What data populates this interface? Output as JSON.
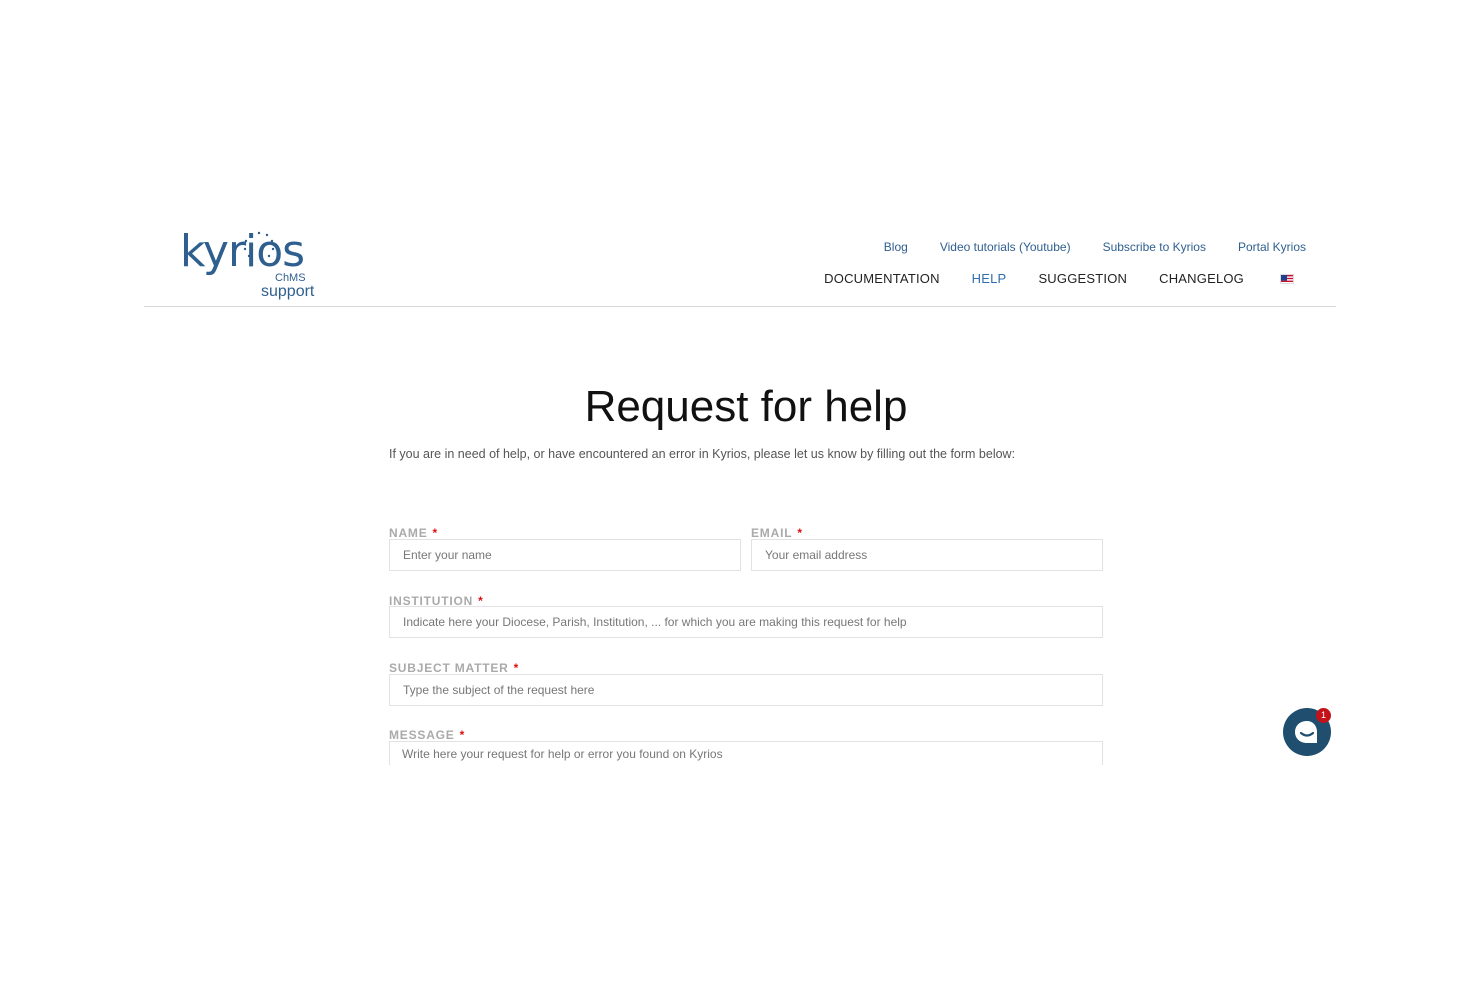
{
  "logo": {
    "word": "kyrios",
    "chms": "ChMS",
    "support": "support"
  },
  "top_links": [
    "Blog",
    "Video tutorials (Youtube)",
    "Subscribe to Kyrios",
    "Portal Kyrios"
  ],
  "nav": {
    "documentation": "DOCUMENTATION",
    "help": "HELP",
    "suggestion": "SUGGESTION",
    "changelog": "CHANGELOG"
  },
  "page": {
    "title": "Request for help",
    "intro": "If you are in need of help, or have encountered an error in Kyrios, please let us know by filling out the form below:"
  },
  "form": {
    "required_mark": "*",
    "name": {
      "label": "NAME",
      "placeholder": "Enter your name"
    },
    "email": {
      "label": "EMAIL",
      "placeholder": "Your email address"
    },
    "institution": {
      "label": "INSTITUTION",
      "placeholder": "Indicate here your Diocese, Parish, Institution, ... for which you are making this request for help"
    },
    "subject": {
      "label": "SUBJECT MATTER",
      "placeholder": "Type the subject of the request here"
    },
    "message": {
      "label": "MESSAGE",
      "placeholder": "Write here your request for help or error you found on Kyrios"
    }
  },
  "chat": {
    "badge": "1"
  },
  "colors": {
    "brand": "#2f5f8f",
    "active_nav": "#2f6fb0",
    "required": "#dd1111",
    "chat": "#1f4e6e",
    "badge": "#c4121a"
  }
}
